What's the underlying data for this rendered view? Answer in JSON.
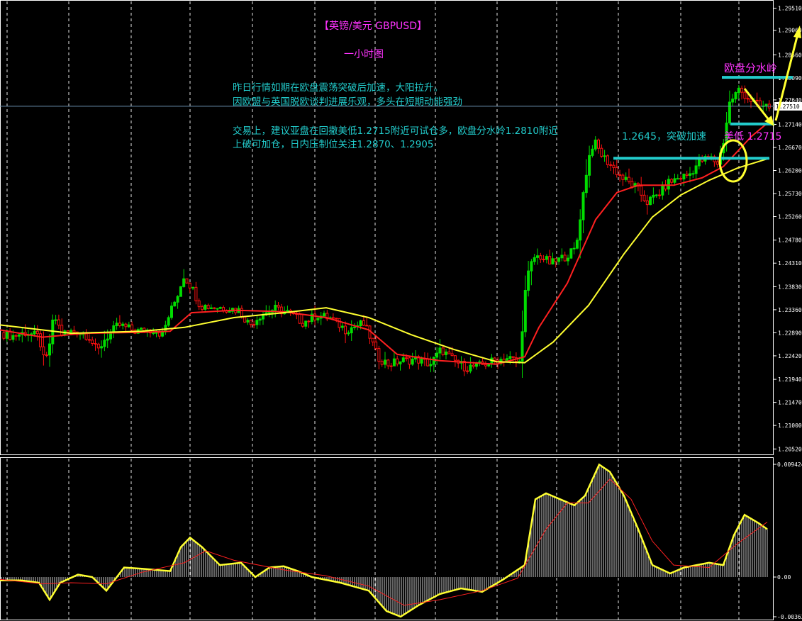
{
  "chart_data": [
    {
      "type": "candlestick",
      "title": "【英镑/美元 GBPUSD】",
      "subtitle": "一小时图",
      "ylim": [
        1.2038,
        1.2962
      ],
      "yticks": [
        "1.29510",
        "1.29060",
        "1.28560",
        "1.28090",
        "1.27640",
        "1.27140",
        "1.26670",
        "1.26200",
        "1.25730",
        "1.25260",
        "1.24780",
        "1.24310",
        "1.23830",
        "1.23360",
        "1.22890",
        "1.22420",
        "1.21940",
        "1.21470",
        "1.21000",
        "1.20520"
      ],
      "current_price": "1.27510",
      "ohlc_path": [
        [
          0,
          1.229
        ],
        [
          20,
          1.2282
        ],
        [
          40,
          1.229
        ],
        [
          58,
          1.228
        ],
        [
          66,
          1.2222
        ],
        [
          72,
          1.226
        ],
        [
          79,
          1.2325
        ],
        [
          90,
          1.2287
        ],
        [
          110,
          1.2293
        ],
        [
          128,
          1.2282
        ],
        [
          140,
          1.225
        ],
        [
          150,
          1.2275
        ],
        [
          170,
          1.2305
        ],
        [
          195,
          1.2292
        ],
        [
          220,
          1.2296
        ],
        [
          232,
          1.2285
        ],
        [
          240,
          1.232
        ],
        [
          252,
          1.2362
        ],
        [
          262,
          1.2405
        ],
        [
          272,
          1.2385
        ],
        [
          285,
          1.2345
        ],
        [
          300,
          1.2342
        ],
        [
          320,
          1.234
        ],
        [
          340,
          1.2335
        ],
        [
          355,
          1.2305
        ],
        [
          370,
          1.2325
        ],
        [
          390,
          1.2338
        ],
        [
          410,
          1.233
        ],
        [
          430,
          1.231
        ],
        [
          450,
          1.2325
        ],
        [
          470,
          1.2318
        ],
        [
          490,
          1.2295
        ],
        [
          515,
          1.2308
        ],
        [
          525,
          1.228
        ],
        [
          535,
          1.224
        ],
        [
          550,
          1.2225
        ],
        [
          570,
          1.2232
        ],
        [
          590,
          1.2235
        ],
        [
          610,
          1.2225
        ],
        [
          625,
          1.2255
        ],
        [
          640,
          1.2235
        ],
        [
          660,
          1.2218
        ],
        [
          680,
          1.2222
        ],
        [
          700,
          1.2232
        ],
        [
          720,
          1.2238
        ],
        [
          735,
          1.2228
        ],
        [
          745,
          1.2395
        ],
        [
          755,
          1.2442
        ],
        [
          765,
          1.2445
        ],
        [
          780,
          1.243
        ],
        [
          800,
          1.2445
        ],
        [
          815,
          1.246
        ],
        [
          825,
          1.257
        ],
        [
          832,
          1.264
        ],
        [
          840,
          1.268
        ],
        [
          852,
          1.265
        ],
        [
          868,
          1.2625
        ],
        [
          880,
          1.2605
        ],
        [
          900,
          1.2585
        ],
        [
          915,
          1.2555
        ],
        [
          930,
          1.257
        ],
        [
          945,
          1.2595
        ],
        [
          960,
          1.2605
        ],
        [
          975,
          1.2612
        ],
        [
          990,
          1.264
        ],
        [
          1005,
          1.2645
        ],
        [
          1015,
          1.2635
        ],
        [
          1022,
          1.267
        ],
        [
          1032,
          1.276
        ],
        [
          1045,
          1.2785
        ],
        [
          1060,
          1.2765
        ],
        [
          1075,
          1.275
        ],
        [
          1090,
          1.2751
        ]
      ],
      "series": [
        {
          "name": "",
          "color": "#ff2020",
          "points": [
            [
              0,
              1.2295
            ],
            [
              60,
              1.228
            ],
            [
              120,
              1.2288
            ],
            [
              200,
              1.229
            ],
            [
              240,
              1.2292
            ],
            [
              270,
              1.233
            ],
            [
              330,
              1.2335
            ],
            [
              400,
              1.2332
            ],
            [
              460,
              1.232
            ],
            [
              520,
              1.2295
            ],
            [
              560,
              1.2245
            ],
            [
              620,
              1.2232
            ],
            [
              700,
              1.2225
            ],
            [
              740,
              1.224
            ],
            [
              760,
              1.23
            ],
            [
              800,
              1.239
            ],
            [
              840,
              1.252
            ],
            [
              870,
              1.2575
            ],
            [
              900,
              1.259
            ],
            [
              950,
              1.259
            ],
            [
              990,
              1.2605
            ],
            [
              1020,
              1.2628
            ],
            [
              1060,
              1.269
            ],
            [
              1085,
              1.272
            ]
          ]
        },
        {
          "name": "",
          "color": "#ffff30",
          "points": [
            [
              0,
              1.2305
            ],
            [
              100,
              1.2288
            ],
            [
              200,
              1.2292
            ],
            [
              260,
              1.23
            ],
            [
              330,
              1.232
            ],
            [
              400,
              1.233
            ],
            [
              460,
              1.234
            ],
            [
              520,
              1.232
            ],
            [
              580,
              1.2285
            ],
            [
              640,
              1.2255
            ],
            [
              700,
              1.223
            ],
            [
              740,
              1.2228
            ],
            [
              780,
              1.227
            ],
            [
              830,
              1.2345
            ],
            [
              880,
              1.245
            ],
            [
              920,
              1.2525
            ],
            [
              960,
              1.257
            ],
            [
              1000,
              1.26
            ],
            [
              1040,
              1.2625
            ],
            [
              1085,
              1.2645
            ]
          ]
        }
      ],
      "annotations": {
        "line1": "昨日行情如期在欧盘震荡突破后加速，大阳拉升。",
        "line2": "因欧盟与英国脱欧谈判进展乐观，多头在短期动能强劲",
        "line3": "交易上，建议亚盘在回撤美低1.2715附近可试仓多，欧盘分水岭1.2810附近",
        "line4": "上破可加仓，日内压制位关注1.2870、1.2905",
        "breakout": "1.2645，突破加速",
        "us_low": "美低  1.2715",
        "watershed": "欧盘分水岭"
      },
      "levels": [
        {
          "price": 1.281,
          "color": "#22cccc"
        },
        {
          "price": 1.2715,
          "color": "#22cccc"
        },
        {
          "price": 1.2645,
          "color": "#22cccc"
        }
      ],
      "grid": true
    },
    {
      "type": "histogram",
      "ylim": [
        -0.00363,
        0.009424
      ],
      "yticks": [
        "0.009424",
        "0.00",
        "-0.00363"
      ],
      "macd_path": [
        [
          0,
          -0.0003
        ],
        [
          30,
          -0.0003
        ],
        [
          55,
          -0.0005
        ],
        [
          70,
          -0.002
        ],
        [
          85,
          -0.0005
        ],
        [
          110,
          0.0002
        ],
        [
          130,
          0.0
        ],
        [
          150,
          -0.0012
        ],
        [
          175,
          0.0008
        ],
        [
          200,
          0.0007
        ],
        [
          240,
          0.0005
        ],
        [
          255,
          0.0025
        ],
        [
          268,
          0.0033
        ],
        [
          285,
          0.0025
        ],
        [
          310,
          0.001
        ],
        [
          340,
          0.0012
        ],
        [
          360,
          0.0
        ],
        [
          380,
          0.0008
        ],
        [
          400,
          0.0009
        ],
        [
          420,
          0.0005
        ],
        [
          440,
          0.0
        ],
        [
          480,
          -0.0005
        ],
        [
          520,
          -0.0012
        ],
        [
          545,
          -0.003
        ],
        [
          565,
          -0.0035
        ],
        [
          590,
          -0.0025
        ],
        [
          620,
          -0.0015
        ],
        [
          650,
          -0.001
        ],
        [
          680,
          -0.0013
        ],
        [
          710,
          -0.0002
        ],
        [
          740,
          0.001
        ],
        [
          755,
          0.0065
        ],
        [
          770,
          0.007
        ],
        [
          790,
          0.0065
        ],
        [
          810,
          0.006
        ],
        [
          825,
          0.0068
        ],
        [
          845,
          0.0094
        ],
        [
          860,
          0.0088
        ],
        [
          880,
          0.0068
        ],
        [
          900,
          0.004
        ],
        [
          920,
          0.001
        ],
        [
          945,
          0.0003
        ],
        [
          965,
          0.0008
        ],
        [
          1000,
          0.0012
        ],
        [
          1020,
          0.001
        ],
        [
          1035,
          0.0035
        ],
        [
          1050,
          0.0052
        ],
        [
          1070,
          0.0045
        ],
        [
          1082,
          0.004
        ]
      ],
      "signal_path": [
        [
          0,
          -0.0002
        ],
        [
          60,
          -0.0006
        ],
        [
          100,
          -0.0005
        ],
        [
          150,
          -0.0006
        ],
        [
          200,
          0.0004
        ],
        [
          260,
          0.0012
        ],
        [
          290,
          0.0022
        ],
        [
          330,
          0.0014
        ],
        [
          400,
          0.0006
        ],
        [
          460,
          0.0001
        ],
        [
          520,
          -0.0008
        ],
        [
          570,
          -0.0025
        ],
        [
          620,
          -0.002
        ],
        [
          680,
          -0.0012
        ],
        [
          730,
          -0.0001
        ],
        [
          770,
          0.004
        ],
        [
          800,
          0.0062
        ],
        [
          830,
          0.0062
        ],
        [
          860,
          0.0082
        ],
        [
          890,
          0.0065
        ],
        [
          920,
          0.003
        ],
        [
          950,
          0.001
        ],
        [
          1000,
          0.0008
        ],
        [
          1040,
          0.0028
        ],
        [
          1082,
          0.0046
        ]
      ]
    }
  ]
}
